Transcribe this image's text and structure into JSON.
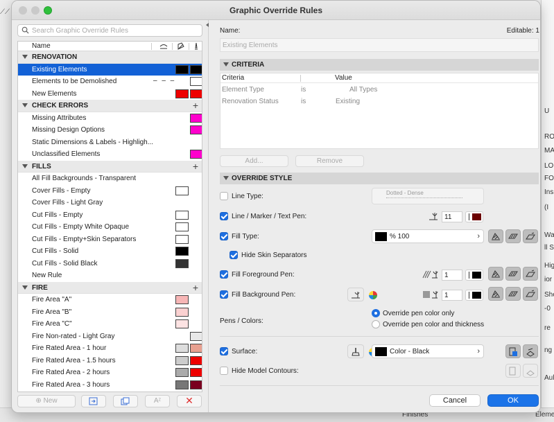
{
  "window": {
    "title": "Graphic Override Rules"
  },
  "background": {
    "right_labels": [
      "U",
      "RO",
      "MA",
      "LO",
      "FO",
      "Ins",
      "(I",
      "Wa",
      "ll S",
      "Hig",
      "ior",
      "She",
      "-0",
      "re",
      "ng",
      "Aul"
    ],
    "bottom_left": "Finishes",
    "bottom_right": "Eleme"
  },
  "search": {
    "placeholder": "Search Graphic Override Rules"
  },
  "list": {
    "column_name": "Name",
    "groups": [
      {
        "label": "RENOVATION",
        "plus": "",
        "items": [
          {
            "label": "Existing Elements",
            "selected": true,
            "sw": [
              "#000000",
              "#000000"
            ]
          },
          {
            "label": "Elements to be Demolished",
            "dash": "– – –",
            "sw": [
              "",
              "#ffffff"
            ]
          },
          {
            "label": "New Elements",
            "sw": [
              "#ee0000",
              "#ee0000"
            ]
          }
        ]
      },
      {
        "label": "CHECK ERRORS",
        "plus": "+",
        "items": [
          {
            "label": "Missing Attributes",
            "sw": [
              "",
              "#ff00cc"
            ]
          },
          {
            "label": "Missing Design Options",
            "sw": [
              "",
              "#ff00cc"
            ]
          },
          {
            "label": "Static Dimensions & Labels - Highligh...",
            "sw": [
              "",
              ""
            ]
          },
          {
            "label": "Unclassified Elements",
            "sw": [
              "",
              "#ff00cc"
            ]
          }
        ]
      },
      {
        "label": "FILLS",
        "plus": "+",
        "items": [
          {
            "label": "All Fill Backgrounds - Transparent",
            "sw": [
              "",
              ""
            ]
          },
          {
            "label": "Cover Fills - Empty",
            "sw": [
              "#ffffff",
              ""
            ]
          },
          {
            "label": "Cover Fills - Light Gray",
            "sw": [
              "",
              ""
            ]
          },
          {
            "label": "Cut Fills - Empty",
            "sw": [
              "#ffffff",
              ""
            ]
          },
          {
            "label": "Cut Fills - Empty White Opaque",
            "sw": [
              "#ffffff",
              ""
            ]
          },
          {
            "label": "Cut Fills - Empty+Skin Separators",
            "sw": [
              "#ffffff",
              ""
            ]
          },
          {
            "label": "Cut Fills - Solid",
            "sw": [
              "#000000",
              ""
            ]
          },
          {
            "label": "Cut Fills - Solid Black",
            "sw": [
              "#333333",
              ""
            ]
          },
          {
            "label": "New Rule",
            "sw": [
              "",
              ""
            ]
          }
        ]
      },
      {
        "label": "FIRE",
        "plus": "+",
        "items": [
          {
            "label": "Fire Area \"A\"",
            "sw": [
              "#f7b6b6",
              ""
            ]
          },
          {
            "label": "Fire Area \"B\"",
            "sw": [
              "#fbd1d1",
              ""
            ]
          },
          {
            "label": "Fire Area \"C\"",
            "sw": [
              "#fde3e3",
              ""
            ]
          },
          {
            "label": "Fire Non-rated - Light Gray",
            "sw": [
              "",
              "#e8e8e8"
            ]
          },
          {
            "label": "Fire Rated Area - 1 hour",
            "sw": [
              "#dddddd",
              "#e8a090"
            ]
          },
          {
            "label": "Fire Rated Area - 1.5 hours",
            "sw": [
              "#cccccc",
              "#ee0000"
            ]
          },
          {
            "label": "Fire Rated Area - 2 hours",
            "sw": [
              "#aaaaaa",
              "#ee0000"
            ]
          },
          {
            "label": "Fire Rated Area - 3 hours",
            "sw": [
              "#777777",
              "#7a0020"
            ]
          }
        ]
      }
    ]
  },
  "bottom_buttons": {
    "new_label": "New",
    "sort_label": "Aᶻ"
  },
  "details": {
    "name_label": "Name:",
    "editable_label": "Editable: 1",
    "name_value": "Existing Elements",
    "criteria": {
      "section": "CRITERIA",
      "col_criteria": "Criteria",
      "col_value": "Value",
      "rows": [
        {
          "criterion": "Element Type",
          "op": "is",
          "value": "All Types"
        },
        {
          "criterion": "Renovation Status",
          "op": "is",
          "value": "Existing"
        }
      ],
      "add_label": "Add...",
      "remove_label": "Remove"
    },
    "override": {
      "section": "OVERRIDE STYLE",
      "line_type_label": "Line Type:",
      "line_type_value": "Dotted - Dense",
      "line_pen_label": "Line / Marker / Text Pen:",
      "line_pen_num": "11",
      "line_pen_color": "#6b0000",
      "fill_type_label": "Fill Type:",
      "fill_type_value": "% 100",
      "hide_skin_label": "Hide Skin Separators",
      "fill_fg_label": "Fill Foreground Pen:",
      "fill_fg_num": "1",
      "fill_bg_label": "Fill Background Pen:",
      "fill_bg_num": "1",
      "pens_colors_label": "Pens / Colors:",
      "radio_1": "Override pen color only",
      "radio_2": "Override pen color and thickness",
      "surface_label": "Surface:",
      "surface_value": "Color - Black",
      "hide_contours_label": "Hide Model Contours:"
    },
    "cancel_label": "Cancel",
    "ok_label": "OK"
  }
}
